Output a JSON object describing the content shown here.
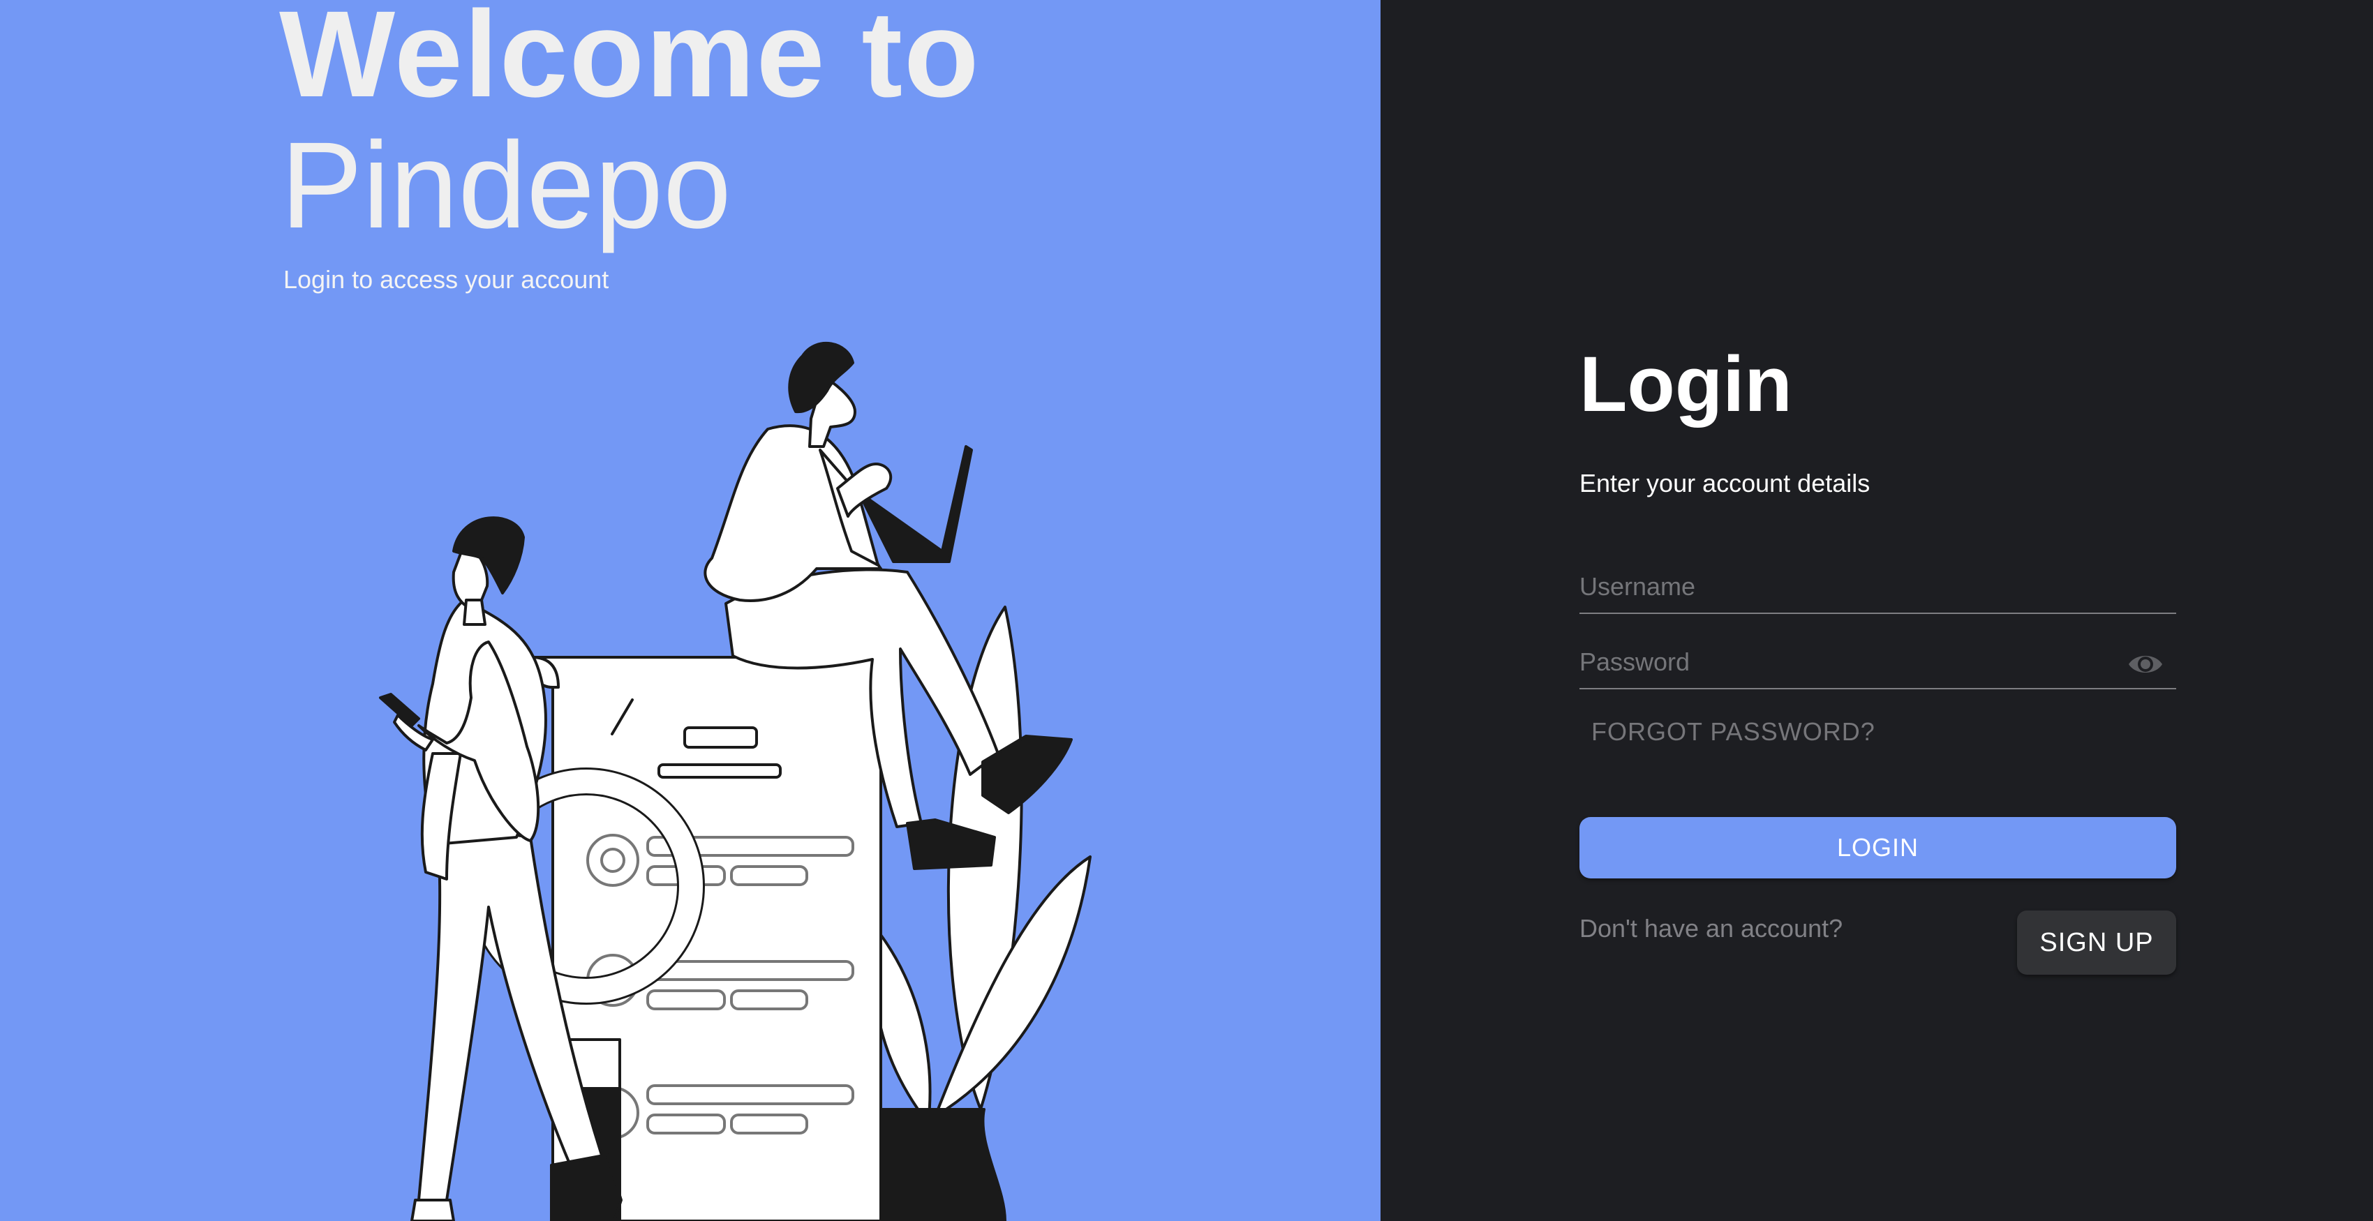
{
  "hero": {
    "title_line1": "Welcome to",
    "title_line2": "Pindepo",
    "subtitle": "Login to access your account"
  },
  "login": {
    "title": "Login",
    "subtitle": "Enter your account details",
    "username_placeholder": "Username",
    "username_value": "",
    "password_placeholder": "Password",
    "password_value": "",
    "forgot_label": "FORGOT PASSWORD?",
    "login_label": "LOGIN",
    "no_account_text": "Don't have an account?",
    "signup_label": "SIGN UP"
  },
  "icons": {
    "password_toggle": "eye-icon"
  },
  "colors": {
    "accent": "#7398f5",
    "dark_background": "#1d1e22",
    "secondary_button": "#323336"
  }
}
